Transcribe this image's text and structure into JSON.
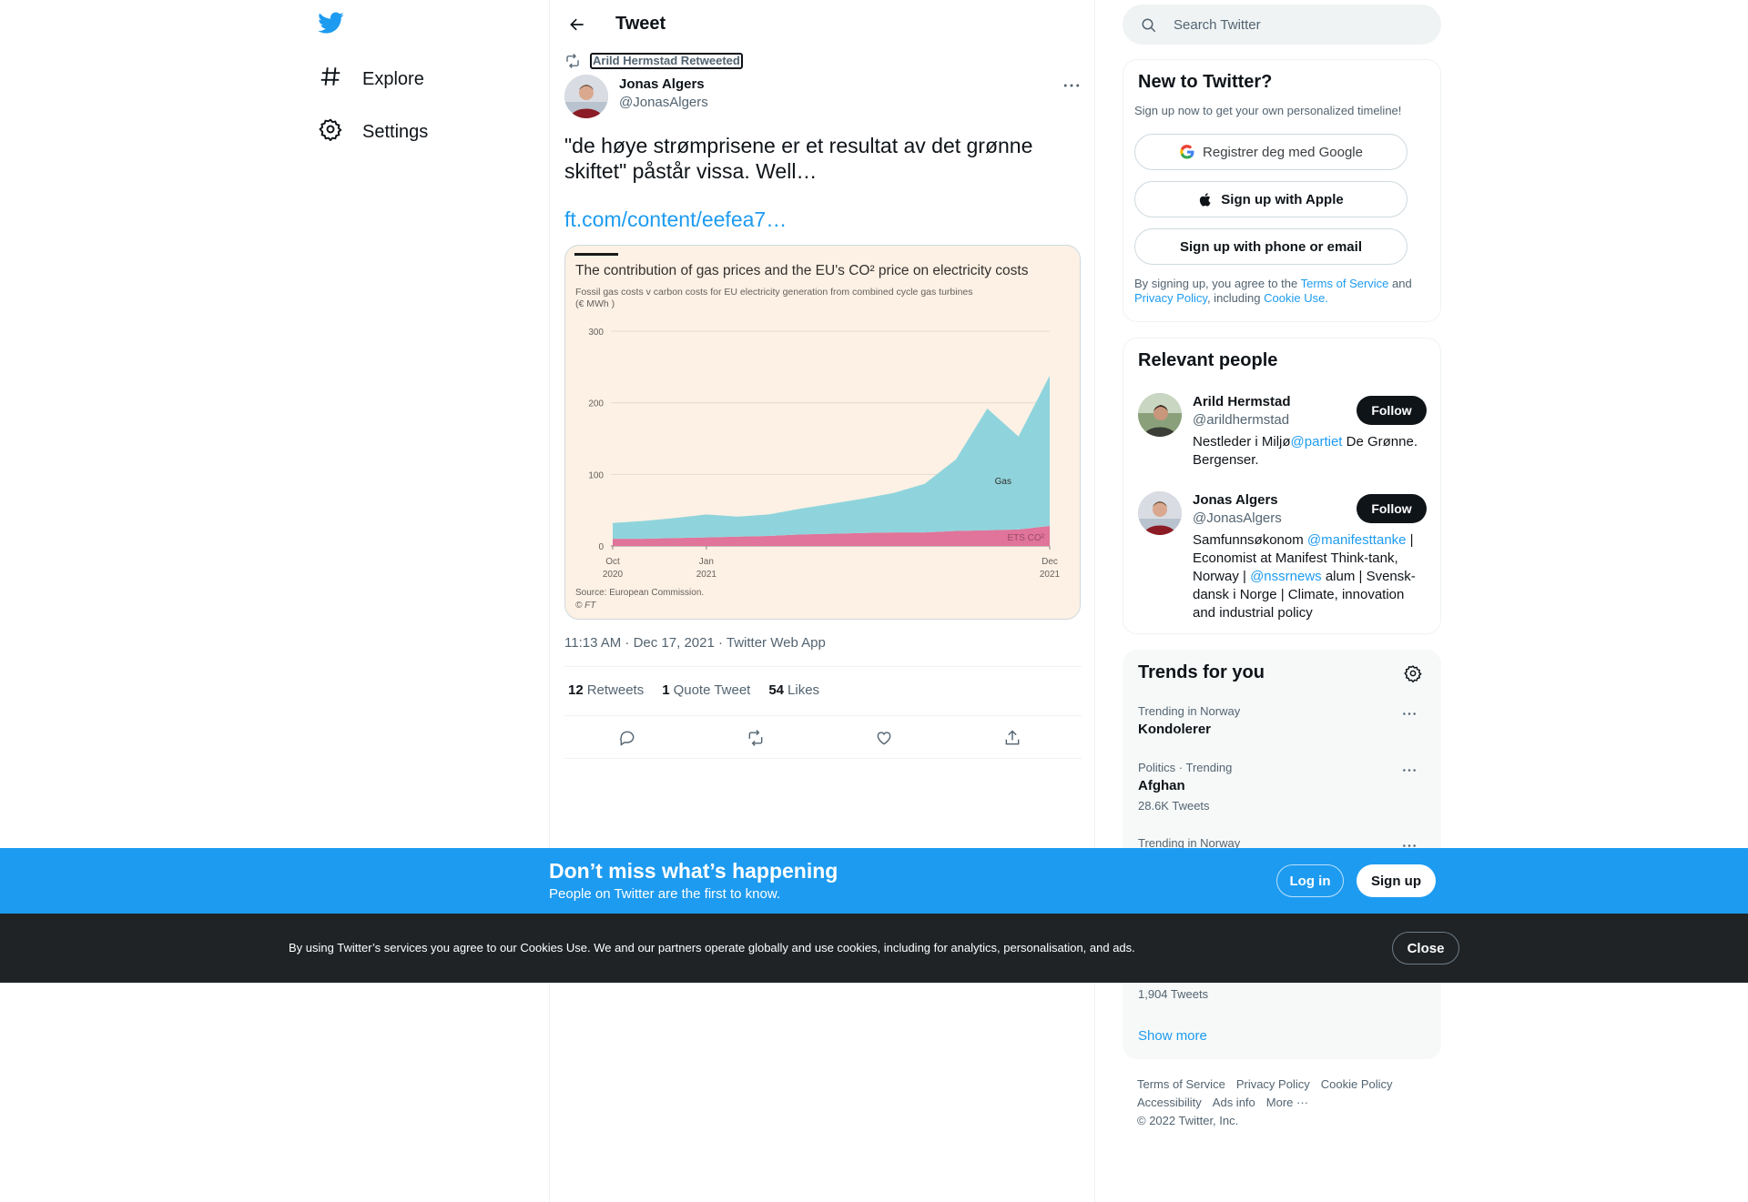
{
  "nav": {
    "items": [
      {
        "label": "Explore",
        "icon": "hashtag-icon"
      },
      {
        "label": "Settings",
        "icon": "gear-icon"
      }
    ]
  },
  "header": {
    "title": "Tweet"
  },
  "tweet": {
    "retweeted_by": "Arild Hermstad Retweeted",
    "author_name": "Jonas Algers",
    "author_handle": "@JonasAlgers",
    "text": "\"de høye strømprisene er et resultat av det grønne skiftet\" påstår vissa. Well…",
    "link": "ft.com/content/eefea7…",
    "meta": "11:13 AM · Dec 17, 2021 · Twitter Web App",
    "stats": [
      {
        "count": "12",
        "label": "Retweets"
      },
      {
        "count": "1",
        "label": "Quote Tweet"
      },
      {
        "count": "54",
        "label": "Likes"
      }
    ]
  },
  "chart_data": {
    "type": "area",
    "title": "The contribution of gas prices and the EU's CO² price on electricity costs",
    "subtitle": "Fossil gas costs v carbon costs for EU electricity generation from combined cycle gas turbines",
    "subtitle2": "(€ MWh )",
    "source": "Source: European Commission.",
    "credit": "© FT",
    "xlabel": "",
    "ylabel": "",
    "ylim": [
      0,
      300
    ],
    "yticks": [
      "300",
      "200",
      "100",
      "0"
    ],
    "xticks": [
      {
        "line1": "Oct",
        "line2": "2020"
      },
      {
        "line1": "Jan",
        "line2": "2021"
      },
      {
        "line1": "Dec",
        "line2": "2021"
      }
    ],
    "x": [
      "2020-10",
      "2020-11",
      "2020-12",
      "2021-01",
      "2021-02",
      "2021-03",
      "2021-04",
      "2021-05",
      "2021-06",
      "2021-07",
      "2021-08",
      "2021-09",
      "2021-10",
      "2021-11",
      "2021-12"
    ],
    "series": [
      {
        "name": "ETS CO²",
        "color": "#e0749a",
        "values": [
          10,
          10,
          11,
          12,
          13,
          14,
          16,
          17,
          18,
          19,
          19,
          21,
          22,
          23,
          28
        ]
      },
      {
        "name": "Gas",
        "color": "#8fd4dc",
        "values": [
          22,
          25,
          28,
          32,
          28,
          30,
          36,
          42,
          48,
          55,
          68,
          100,
          170,
          130,
          210
        ]
      }
    ],
    "annotations": [
      "Gas",
      "ETS CO²"
    ]
  },
  "sidebar": {
    "search_placeholder": "Search Twitter",
    "signup": {
      "title": "New to Twitter?",
      "sub": "Sign up now to get your own personalized timeline!",
      "google": "Registrer deg med Google",
      "apple": "Sign up with Apple",
      "phone": "Sign up with phone or email",
      "terms_1": "By signing up, you agree to the ",
      "terms_tos": "Terms of Service",
      "terms_2": " and ",
      "terms_privacy": "Privacy Policy",
      "terms_3": ", including ",
      "terms_cookie": "Cookie Use."
    },
    "relevant": {
      "title": "Relevant people",
      "people": [
        {
          "name": "Arild Hermstad",
          "handle": "@arildhermstad",
          "bio_1": "Nestleder i Miljø",
          "bio_link1": "@partiet",
          "bio_2": " De Grønne. Bergenser.",
          "follow": "Follow"
        },
        {
          "name": "Jonas Algers",
          "handle": "@JonasAlgers",
          "bio_1": "Samfunnsøkonom ",
          "bio_link1": "@manifesttanke",
          "bio_2": " | Economist at Manifest Think-tank, Norway | ",
          "bio_link2": "@nssrnews",
          "bio_3": " alum | Svensk-dansk i Norge | Climate, innovation and industrial policy",
          "follow": "Follow"
        }
      ]
    },
    "trends": {
      "title": "Trends for you",
      "items": [
        {
          "context": "Trending in Norway",
          "name": "Kondolerer",
          "count": ""
        },
        {
          "context": "Politics · Trending",
          "name": "Afghan",
          "count": "28.6K Tweets"
        },
        {
          "context": "Trending in Norway",
          "name": "",
          "count": ""
        }
      ],
      "partial_count": "1,904 Tweets",
      "show_more": "Show more"
    },
    "footer": {
      "row1": [
        "Terms of Service",
        "Privacy Policy",
        "Cookie Policy"
      ],
      "row2": [
        "Accessibility",
        "Ads info",
        "More ···"
      ],
      "copyright": "© 2022 Twitter, Inc."
    }
  },
  "banner": {
    "title": "Don’t miss what’s happening",
    "sub": "People on Twitter are the first to know.",
    "login": "Log in",
    "signup": "Sign up"
  },
  "cookie": {
    "text": "By using Twitter’s services you agree to our Cookies Use. We and our partners operate globally and use cookies, including for analytics, personalisation, and ads.",
    "close": "Close"
  },
  "colors": {
    "accent": "#1d9bf0",
    "text": "#0f1419",
    "muted": "#536471",
    "cookie_bg": "#1f2326",
    "chart_bg": "#fdf1e5"
  }
}
